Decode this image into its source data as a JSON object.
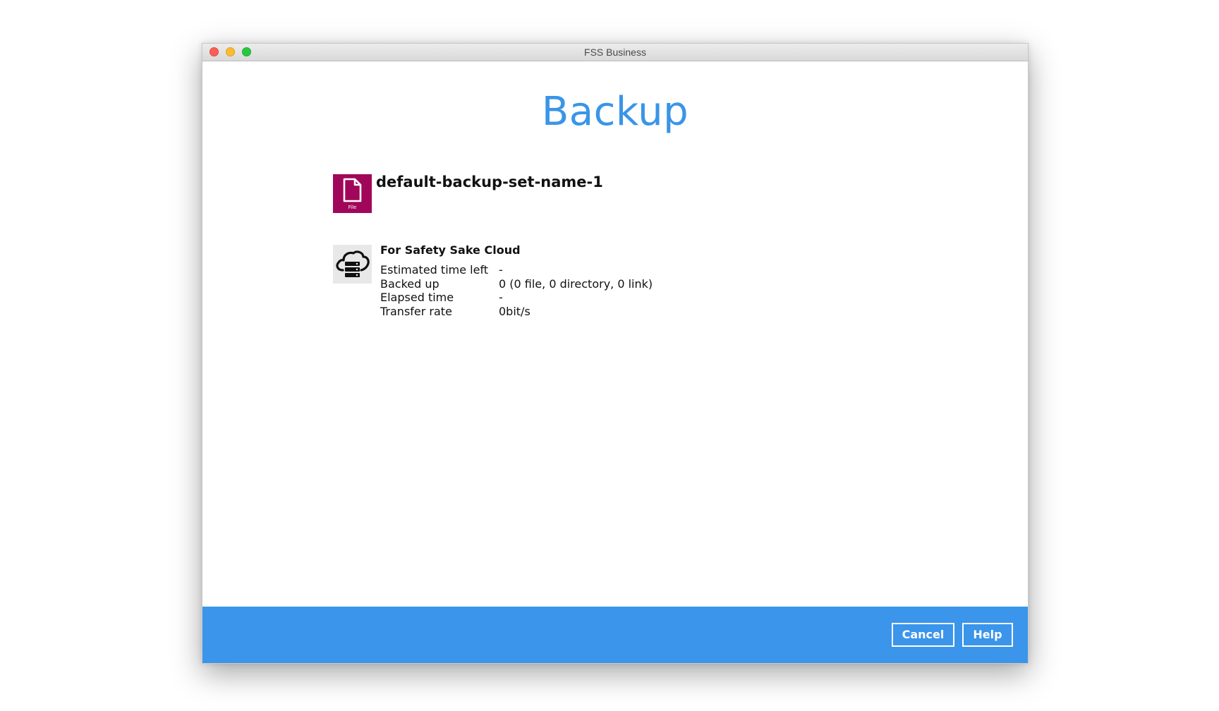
{
  "window": {
    "title": "FSS Business"
  },
  "page": {
    "title": "Backup"
  },
  "backup_set": {
    "icon": "file-icon",
    "icon_label": "File",
    "name": "default-backup-set-name-1"
  },
  "destination": {
    "icon": "cloud-server-icon",
    "name": "For Safety Sake Cloud",
    "stats": [
      {
        "label": "Estimated time left",
        "value": "-"
      },
      {
        "label": "Backed up",
        "value": "0 (0 file, 0 directory, 0 link)"
      },
      {
        "label": "Elapsed time",
        "value": "-"
      },
      {
        "label": "Transfer rate",
        "value": "0bit/s"
      }
    ]
  },
  "footer": {
    "cancel_label": "Cancel",
    "help_label": "Help"
  },
  "colors": {
    "accent": "#3a95e7",
    "footer": "#3a95eb",
    "file_icon_bg": "#a0075a"
  }
}
